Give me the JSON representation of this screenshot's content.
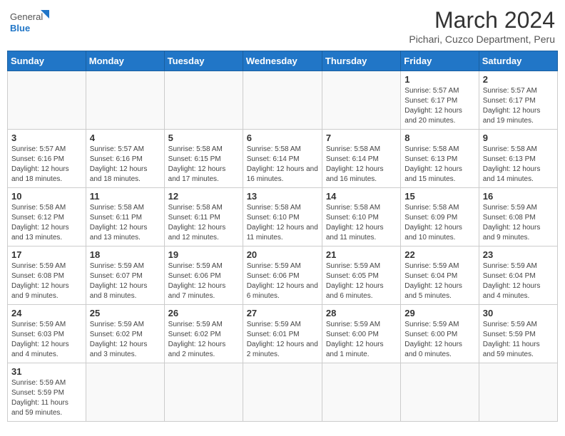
{
  "header": {
    "logo_general": "General",
    "logo_blue": "Blue",
    "month_title": "March 2024",
    "location": "Pichari, Cuzco Department, Peru"
  },
  "weekdays": [
    "Sunday",
    "Monday",
    "Tuesday",
    "Wednesday",
    "Thursday",
    "Friday",
    "Saturday"
  ],
  "weeks": [
    [
      {
        "day": "",
        "info": ""
      },
      {
        "day": "",
        "info": ""
      },
      {
        "day": "",
        "info": ""
      },
      {
        "day": "",
        "info": ""
      },
      {
        "day": "",
        "info": ""
      },
      {
        "day": "1",
        "info": "Sunrise: 5:57 AM\nSunset: 6:17 PM\nDaylight: 12 hours\nand 20 minutes."
      },
      {
        "day": "2",
        "info": "Sunrise: 5:57 AM\nSunset: 6:17 PM\nDaylight: 12 hours\nand 19 minutes."
      }
    ],
    [
      {
        "day": "3",
        "info": "Sunrise: 5:57 AM\nSunset: 6:16 PM\nDaylight: 12 hours\nand 18 minutes."
      },
      {
        "day": "4",
        "info": "Sunrise: 5:57 AM\nSunset: 6:16 PM\nDaylight: 12 hours\nand 18 minutes."
      },
      {
        "day": "5",
        "info": "Sunrise: 5:58 AM\nSunset: 6:15 PM\nDaylight: 12 hours\nand 17 minutes."
      },
      {
        "day": "6",
        "info": "Sunrise: 5:58 AM\nSunset: 6:14 PM\nDaylight: 12 hours\nand 16 minutes."
      },
      {
        "day": "7",
        "info": "Sunrise: 5:58 AM\nSunset: 6:14 PM\nDaylight: 12 hours\nand 16 minutes."
      },
      {
        "day": "8",
        "info": "Sunrise: 5:58 AM\nSunset: 6:13 PM\nDaylight: 12 hours\nand 15 minutes."
      },
      {
        "day": "9",
        "info": "Sunrise: 5:58 AM\nSunset: 6:13 PM\nDaylight: 12 hours\nand 14 minutes."
      }
    ],
    [
      {
        "day": "10",
        "info": "Sunrise: 5:58 AM\nSunset: 6:12 PM\nDaylight: 12 hours\nand 13 minutes."
      },
      {
        "day": "11",
        "info": "Sunrise: 5:58 AM\nSunset: 6:11 PM\nDaylight: 12 hours\nand 13 minutes."
      },
      {
        "day": "12",
        "info": "Sunrise: 5:58 AM\nSunset: 6:11 PM\nDaylight: 12 hours\nand 12 minutes."
      },
      {
        "day": "13",
        "info": "Sunrise: 5:58 AM\nSunset: 6:10 PM\nDaylight: 12 hours\nand 11 minutes."
      },
      {
        "day": "14",
        "info": "Sunrise: 5:58 AM\nSunset: 6:10 PM\nDaylight: 12 hours\nand 11 minutes."
      },
      {
        "day": "15",
        "info": "Sunrise: 5:58 AM\nSunset: 6:09 PM\nDaylight: 12 hours\nand 10 minutes."
      },
      {
        "day": "16",
        "info": "Sunrise: 5:59 AM\nSunset: 6:08 PM\nDaylight: 12 hours\nand 9 minutes."
      }
    ],
    [
      {
        "day": "17",
        "info": "Sunrise: 5:59 AM\nSunset: 6:08 PM\nDaylight: 12 hours\nand 9 minutes."
      },
      {
        "day": "18",
        "info": "Sunrise: 5:59 AM\nSunset: 6:07 PM\nDaylight: 12 hours\nand 8 minutes."
      },
      {
        "day": "19",
        "info": "Sunrise: 5:59 AM\nSunset: 6:06 PM\nDaylight: 12 hours\nand 7 minutes."
      },
      {
        "day": "20",
        "info": "Sunrise: 5:59 AM\nSunset: 6:06 PM\nDaylight: 12 hours\nand 6 minutes."
      },
      {
        "day": "21",
        "info": "Sunrise: 5:59 AM\nSunset: 6:05 PM\nDaylight: 12 hours\nand 6 minutes."
      },
      {
        "day": "22",
        "info": "Sunrise: 5:59 AM\nSunset: 6:04 PM\nDaylight: 12 hours\nand 5 minutes."
      },
      {
        "day": "23",
        "info": "Sunrise: 5:59 AM\nSunset: 6:04 PM\nDaylight: 12 hours\nand 4 minutes."
      }
    ],
    [
      {
        "day": "24",
        "info": "Sunrise: 5:59 AM\nSunset: 6:03 PM\nDaylight: 12 hours\nand 4 minutes."
      },
      {
        "day": "25",
        "info": "Sunrise: 5:59 AM\nSunset: 6:02 PM\nDaylight: 12 hours\nand 3 minutes."
      },
      {
        "day": "26",
        "info": "Sunrise: 5:59 AM\nSunset: 6:02 PM\nDaylight: 12 hours\nand 2 minutes."
      },
      {
        "day": "27",
        "info": "Sunrise: 5:59 AM\nSunset: 6:01 PM\nDaylight: 12 hours\nand 2 minutes."
      },
      {
        "day": "28",
        "info": "Sunrise: 5:59 AM\nSunset: 6:00 PM\nDaylight: 12 hours\nand 1 minute."
      },
      {
        "day": "29",
        "info": "Sunrise: 5:59 AM\nSunset: 6:00 PM\nDaylight: 12 hours\nand 0 minutes."
      },
      {
        "day": "30",
        "info": "Sunrise: 5:59 AM\nSunset: 5:59 PM\nDaylight: 11 hours\nand 59 minutes."
      }
    ],
    [
      {
        "day": "31",
        "info": "Sunrise: 5:59 AM\nSunset: 5:59 PM\nDaylight: 11 hours\nand 59 minutes."
      },
      {
        "day": "",
        "info": ""
      },
      {
        "day": "",
        "info": ""
      },
      {
        "day": "",
        "info": ""
      },
      {
        "day": "",
        "info": ""
      },
      {
        "day": "",
        "info": ""
      },
      {
        "day": "",
        "info": ""
      }
    ]
  ]
}
